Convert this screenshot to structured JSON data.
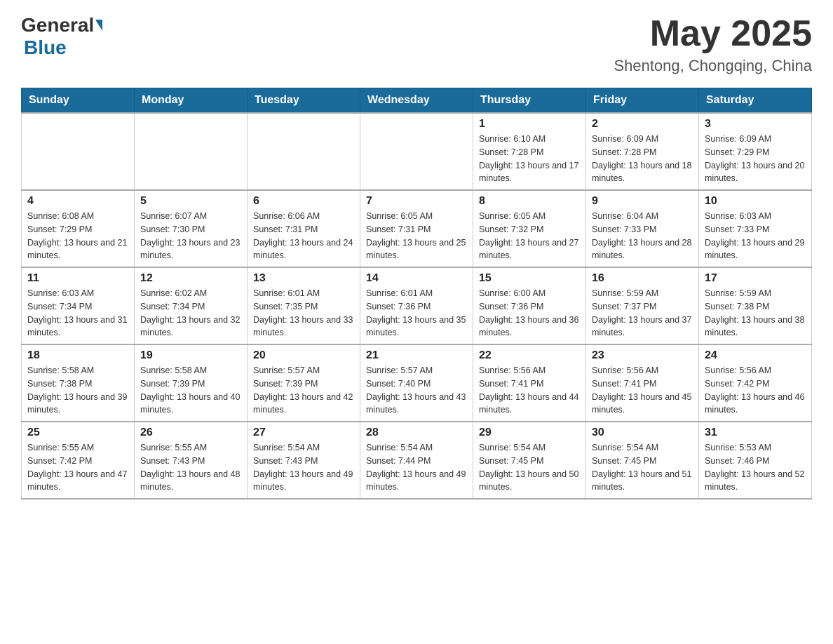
{
  "header": {
    "logo_general": "General",
    "logo_blue": "Blue",
    "month_title": "May 2025",
    "location": "Shentong, Chongqing, China"
  },
  "days_of_week": [
    "Sunday",
    "Monday",
    "Tuesday",
    "Wednesday",
    "Thursday",
    "Friday",
    "Saturday"
  ],
  "weeks": [
    [
      {
        "day": "",
        "info": ""
      },
      {
        "day": "",
        "info": ""
      },
      {
        "day": "",
        "info": ""
      },
      {
        "day": "",
        "info": ""
      },
      {
        "day": "1",
        "info": "Sunrise: 6:10 AM\nSunset: 7:28 PM\nDaylight: 13 hours and 17 minutes."
      },
      {
        "day": "2",
        "info": "Sunrise: 6:09 AM\nSunset: 7:28 PM\nDaylight: 13 hours and 18 minutes."
      },
      {
        "day": "3",
        "info": "Sunrise: 6:09 AM\nSunset: 7:29 PM\nDaylight: 13 hours and 20 minutes."
      }
    ],
    [
      {
        "day": "4",
        "info": "Sunrise: 6:08 AM\nSunset: 7:29 PM\nDaylight: 13 hours and 21 minutes."
      },
      {
        "day": "5",
        "info": "Sunrise: 6:07 AM\nSunset: 7:30 PM\nDaylight: 13 hours and 23 minutes."
      },
      {
        "day": "6",
        "info": "Sunrise: 6:06 AM\nSunset: 7:31 PM\nDaylight: 13 hours and 24 minutes."
      },
      {
        "day": "7",
        "info": "Sunrise: 6:05 AM\nSunset: 7:31 PM\nDaylight: 13 hours and 25 minutes."
      },
      {
        "day": "8",
        "info": "Sunrise: 6:05 AM\nSunset: 7:32 PM\nDaylight: 13 hours and 27 minutes."
      },
      {
        "day": "9",
        "info": "Sunrise: 6:04 AM\nSunset: 7:33 PM\nDaylight: 13 hours and 28 minutes."
      },
      {
        "day": "10",
        "info": "Sunrise: 6:03 AM\nSunset: 7:33 PM\nDaylight: 13 hours and 29 minutes."
      }
    ],
    [
      {
        "day": "11",
        "info": "Sunrise: 6:03 AM\nSunset: 7:34 PM\nDaylight: 13 hours and 31 minutes."
      },
      {
        "day": "12",
        "info": "Sunrise: 6:02 AM\nSunset: 7:34 PM\nDaylight: 13 hours and 32 minutes."
      },
      {
        "day": "13",
        "info": "Sunrise: 6:01 AM\nSunset: 7:35 PM\nDaylight: 13 hours and 33 minutes."
      },
      {
        "day": "14",
        "info": "Sunrise: 6:01 AM\nSunset: 7:36 PM\nDaylight: 13 hours and 35 minutes."
      },
      {
        "day": "15",
        "info": "Sunrise: 6:00 AM\nSunset: 7:36 PM\nDaylight: 13 hours and 36 minutes."
      },
      {
        "day": "16",
        "info": "Sunrise: 5:59 AM\nSunset: 7:37 PM\nDaylight: 13 hours and 37 minutes."
      },
      {
        "day": "17",
        "info": "Sunrise: 5:59 AM\nSunset: 7:38 PM\nDaylight: 13 hours and 38 minutes."
      }
    ],
    [
      {
        "day": "18",
        "info": "Sunrise: 5:58 AM\nSunset: 7:38 PM\nDaylight: 13 hours and 39 minutes."
      },
      {
        "day": "19",
        "info": "Sunrise: 5:58 AM\nSunset: 7:39 PM\nDaylight: 13 hours and 40 minutes."
      },
      {
        "day": "20",
        "info": "Sunrise: 5:57 AM\nSunset: 7:39 PM\nDaylight: 13 hours and 42 minutes."
      },
      {
        "day": "21",
        "info": "Sunrise: 5:57 AM\nSunset: 7:40 PM\nDaylight: 13 hours and 43 minutes."
      },
      {
        "day": "22",
        "info": "Sunrise: 5:56 AM\nSunset: 7:41 PM\nDaylight: 13 hours and 44 minutes."
      },
      {
        "day": "23",
        "info": "Sunrise: 5:56 AM\nSunset: 7:41 PM\nDaylight: 13 hours and 45 minutes."
      },
      {
        "day": "24",
        "info": "Sunrise: 5:56 AM\nSunset: 7:42 PM\nDaylight: 13 hours and 46 minutes."
      }
    ],
    [
      {
        "day": "25",
        "info": "Sunrise: 5:55 AM\nSunset: 7:42 PM\nDaylight: 13 hours and 47 minutes."
      },
      {
        "day": "26",
        "info": "Sunrise: 5:55 AM\nSunset: 7:43 PM\nDaylight: 13 hours and 48 minutes."
      },
      {
        "day": "27",
        "info": "Sunrise: 5:54 AM\nSunset: 7:43 PM\nDaylight: 13 hours and 49 minutes."
      },
      {
        "day": "28",
        "info": "Sunrise: 5:54 AM\nSunset: 7:44 PM\nDaylight: 13 hours and 49 minutes."
      },
      {
        "day": "29",
        "info": "Sunrise: 5:54 AM\nSunset: 7:45 PM\nDaylight: 13 hours and 50 minutes."
      },
      {
        "day": "30",
        "info": "Sunrise: 5:54 AM\nSunset: 7:45 PM\nDaylight: 13 hours and 51 minutes."
      },
      {
        "day": "31",
        "info": "Sunrise: 5:53 AM\nSunset: 7:46 PM\nDaylight: 13 hours and 52 minutes."
      }
    ]
  ]
}
